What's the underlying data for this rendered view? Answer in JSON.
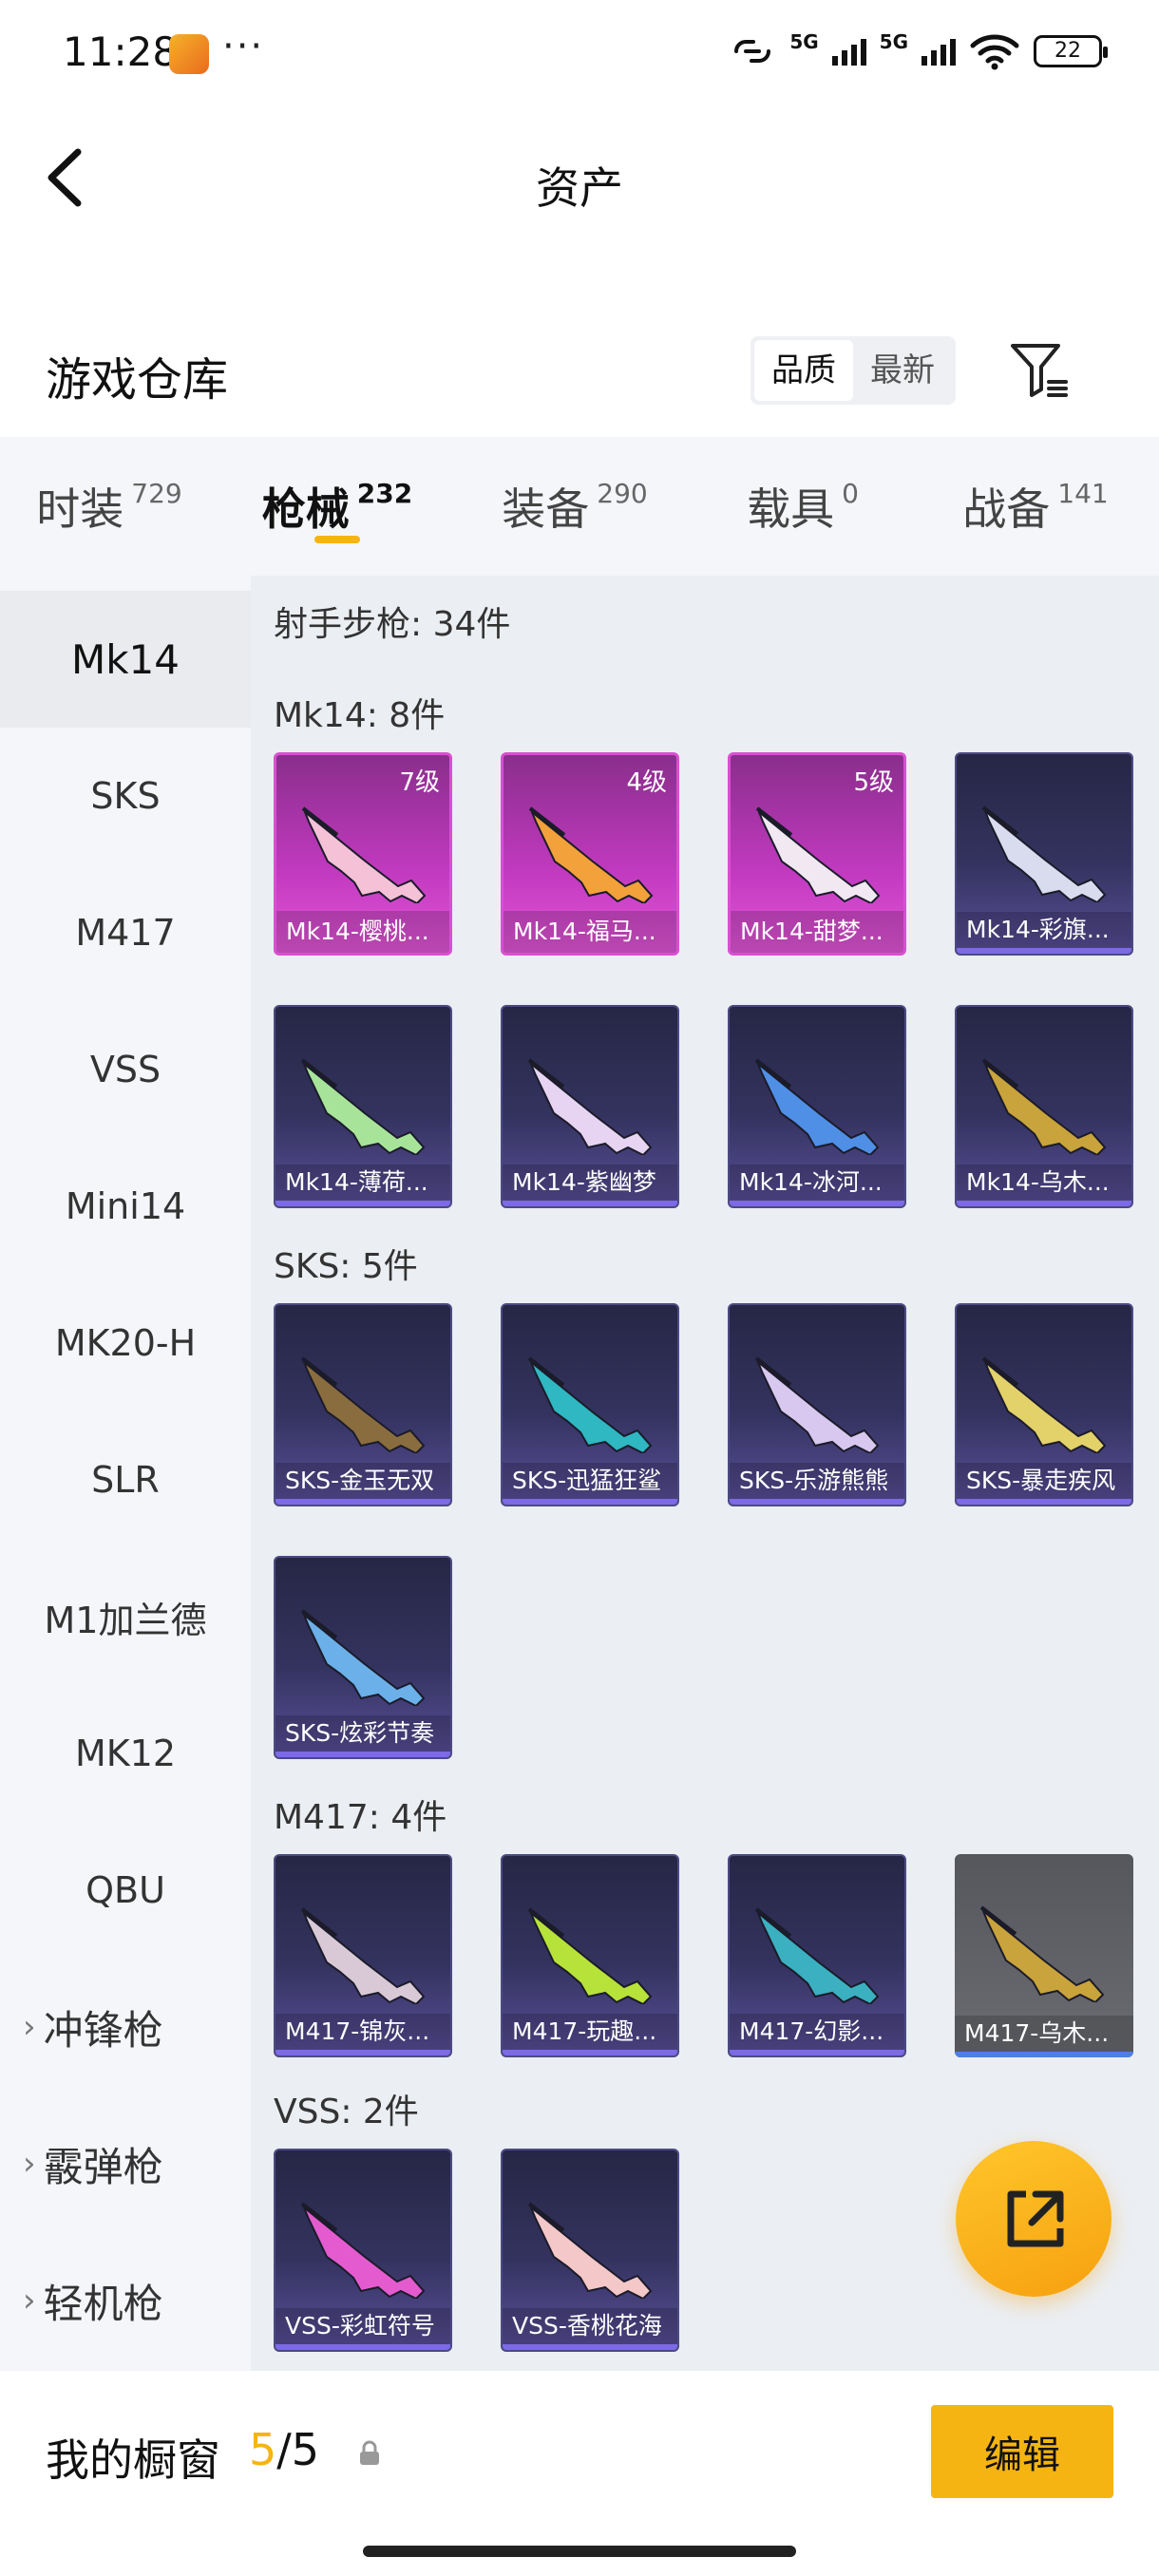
{
  "status": {
    "time": "11:28",
    "dots": "···",
    "net1": "5G",
    "net2": "5G",
    "battery": "22"
  },
  "header": {
    "title": "资产"
  },
  "section": {
    "title": "游戏仓库",
    "sort": [
      "品质",
      "最新"
    ]
  },
  "tabs": [
    {
      "label": "时装",
      "count": "729"
    },
    {
      "label": "枪械",
      "count": "232"
    },
    {
      "label": "装备",
      "count": "290"
    },
    {
      "label": "载具",
      "count": "0"
    },
    {
      "label": "战备",
      "count": "141"
    }
  ],
  "sidebar": {
    "items": [
      "Mk14",
      "SKS",
      "M417",
      "VSS",
      "Mini14",
      "MK20-H",
      "SLR",
      "M1加兰德",
      "MK12",
      "QBU"
    ],
    "groups": [
      "冲锋枪",
      "霰弹枪",
      "轻机枪"
    ]
  },
  "main": {
    "category": "射手步枪: 34件",
    "groups": [
      {
        "label": "Mk14: 8件",
        "items": [
          {
            "name": "Mk14-樱桃...",
            "level": "7级",
            "style": "pink",
            "gun": "#f4c1d6"
          },
          {
            "name": "Mk14-福马...",
            "level": "4级",
            "style": "pink",
            "gun": "#f3a13a"
          },
          {
            "name": "Mk14-甜梦...",
            "level": "5级",
            "style": "pink",
            "gun": "#f1e8f2"
          },
          {
            "name": "Mk14-彩旗...",
            "level": "",
            "style": "purple",
            "gun": "#d9dcef"
          },
          {
            "name": "Mk14-薄荷...",
            "level": "",
            "style": "purple",
            "gun": "#a7e49a"
          },
          {
            "name": "Mk14-紫幽梦",
            "level": "",
            "style": "purple",
            "gun": "#e6d4f2"
          },
          {
            "name": "Mk14-冰河...",
            "level": "",
            "style": "purple",
            "gun": "#4f8fe6"
          },
          {
            "name": "Mk14-乌木...",
            "level": "",
            "style": "purple",
            "gun": "#c9a33b"
          }
        ]
      },
      {
        "label": "SKS: 5件",
        "items": [
          {
            "name": "SKS-金玉无双",
            "level": "",
            "style": "purple",
            "gun": "#8a6d3e"
          },
          {
            "name": "SKS-迅猛狂鲨",
            "level": "",
            "style": "purple",
            "gun": "#2fb7c2"
          },
          {
            "name": "SKS-乐游熊熊",
            "level": "",
            "style": "purple",
            "gun": "#d8c8ef"
          },
          {
            "name": "SKS-暴走疾风",
            "level": "",
            "style": "purple",
            "gun": "#e3d16a"
          },
          {
            "name": "SKS-炫彩节奏",
            "level": "",
            "style": "purple",
            "gun": "#6bb0e8"
          }
        ]
      },
      {
        "label": "M417: 4件",
        "items": [
          {
            "name": "M417-锦灰...",
            "level": "",
            "style": "purple",
            "gun": "#d9c9d6"
          },
          {
            "name": "M417-玩趣...",
            "level": "",
            "style": "purple",
            "gun": "#b7e23a"
          },
          {
            "name": "M417-幻影...",
            "level": "",
            "style": "purple",
            "gun": "#3ab0c0"
          },
          {
            "name": "M417-乌木...",
            "level": "",
            "style": "gray",
            "gun": "#c9a33b"
          }
        ]
      },
      {
        "label": "VSS: 2件",
        "items": [
          {
            "name": "VSS-彩虹符号",
            "level": "",
            "style": "purple",
            "gun": "#e45bd0"
          },
          {
            "name": "VSS-香桃花海",
            "level": "",
            "style": "purple",
            "gun": "#f4c7c9"
          }
        ]
      }
    ]
  },
  "bottom": {
    "label": "我的橱窗",
    "count_current": "5",
    "count_sep": "/",
    "count_total": "5",
    "edit": "编辑"
  },
  "colors": {
    "accent": "#f6b412",
    "rare_pink": "#d94fd0",
    "epic_purple": "#34335f"
  }
}
